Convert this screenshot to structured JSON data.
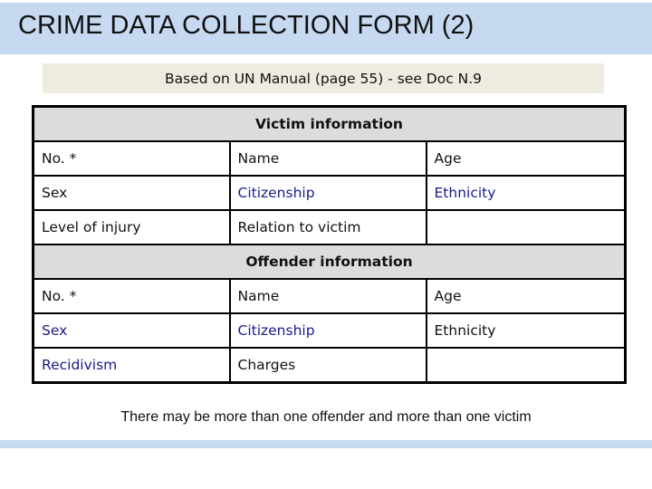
{
  "header": {
    "title": "CRIME DATA COLLECTION FORM (2)",
    "subtitle": "Based on UN Manual (page 55) - see Doc N.9"
  },
  "victim": {
    "section_label": "Victim information",
    "rows": [
      [
        {
          "text": "No. *",
          "highlight": false
        },
        {
          "text": "Name",
          "highlight": false
        },
        {
          "text": "Age",
          "highlight": false
        }
      ],
      [
        {
          "text": "Sex",
          "highlight": false
        },
        {
          "text": "Citizenship",
          "highlight": true
        },
        {
          "text": "Ethnicity",
          "highlight": true
        }
      ],
      [
        {
          "text": "Level of injury",
          "highlight": false
        },
        {
          "text": "Relation to victim",
          "highlight": false
        },
        {
          "text": "",
          "highlight": false
        }
      ]
    ]
  },
  "offender": {
    "section_label": "Offender information",
    "rows": [
      [
        {
          "text": "No. *",
          "highlight": false
        },
        {
          "text": "Name",
          "highlight": false
        },
        {
          "text": "Age",
          "highlight": false
        }
      ],
      [
        {
          "text": "Sex",
          "highlight": true
        },
        {
          "text": "Citizenship",
          "highlight": true
        },
        {
          "text": "Ethnicity",
          "highlight": false
        }
      ],
      [
        {
          "text": "Recidivism",
          "highlight": true
        },
        {
          "text": "Charges",
          "highlight": false
        },
        {
          "text": "",
          "highlight": false
        }
      ]
    ]
  },
  "footer": {
    "note": "There may be more than one offender and more than one victim"
  },
  "colors": {
    "title_bar": "#c6d9f0",
    "subtitle_box": "#eeece1",
    "section_header": "#dcdcdc",
    "highlight_text": "#1a1a8c"
  }
}
